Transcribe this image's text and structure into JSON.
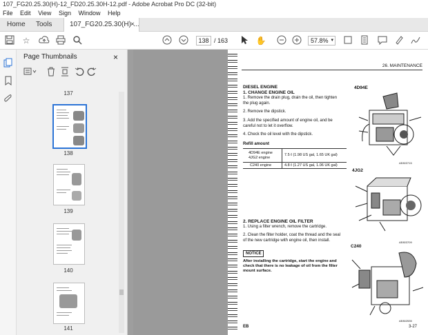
{
  "window": {
    "title": "107_FG20.25.30(H)-12_FD20.25.30H-12.pdf - Adobe Acrobat Pro DC (32-bit)"
  },
  "menu": [
    "File",
    "Edit",
    "View",
    "Sign",
    "Window",
    "Help"
  ],
  "tabs": {
    "home": "Home",
    "tools": "Tools",
    "document": "107_FG20.25.30(H)-...",
    "close": "×"
  },
  "toolbar": {
    "page_current": "138",
    "page_total": "/ 163",
    "zoom": "57.8%"
  },
  "thumbnails": {
    "title": "Page Thumbnails",
    "close": "×",
    "pages": [
      "137",
      "138",
      "139",
      "140",
      "141"
    ]
  },
  "document": {
    "header": "26. MAINTENANCE",
    "section1_title": "DIESEL ENGINE",
    "section1_sub": "1. CHANGE ENGINE OIL",
    "steps1": [
      "1.  Remove the drain plug, drain the oil, then tighten",
      "     the plug again.",
      "2.  Remove the dipstick.",
      "3.  Add the specified amount of engine oil, and be",
      "     careful not to let it overflow.",
      "4.  Check the oil level with the dipstick."
    ],
    "refill_label": "Refill amount",
    "refill_rows": [
      {
        "engine": "4D94E engine",
        "amount": "7.5 ℓ (1.98 US gal, 1.65 UK gal)"
      },
      {
        "engine": "4JG2 engine",
        "amount": ""
      },
      {
        "engine": "C240 engine",
        "amount": "4.8 ℓ (1.27 US gal, 1.06 UK gal)"
      }
    ],
    "section2_sub": "2. REPLACE ENGINE OIL FILTER",
    "steps2": [
      "1.  Using a filter wrench, remove the cartridge.",
      "2.  Clean the filter holder, coat the thread and the seal",
      "     of the new cartridge with engine oil, then install."
    ],
    "notice_label": "NOTICE",
    "notice_text": [
      "After installing the cartridge, start the engine and",
      "check that there is no leakage of oil from the filter",
      "mount surface."
    ],
    "engine_labels": [
      "4D94E",
      "4JG2",
      "C240"
    ],
    "figure_codes": [
      "AE803715",
      "AE803709",
      "AE802535"
    ],
    "footer_left": "EB",
    "footer_right": "3-27"
  }
}
